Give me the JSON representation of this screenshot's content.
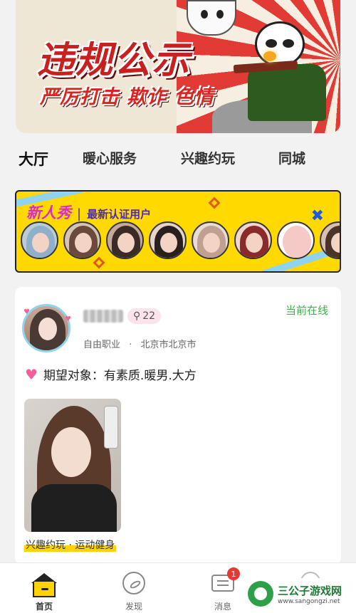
{
  "banner": {
    "title": "违规公示",
    "subtitle": "严厉打击 欺诈 色情"
  },
  "tabs": [
    {
      "label": "大厅",
      "active": true
    },
    {
      "label": "暖心服务",
      "active": false
    },
    {
      "label": "兴趣约玩",
      "active": false
    },
    {
      "label": "同城",
      "active": false
    }
  ],
  "new_members": {
    "title": "新人秀",
    "separator": "|",
    "subtitle": "最新认证用户",
    "avatar_colors": [
      "#8fb0c8",
      "#6a4a3c",
      "#3b2b26",
      "#2a1f1f",
      "#c0a090",
      "#8a2a2a",
      "#f4c9c6",
      "#4a3328"
    ]
  },
  "card": {
    "age": "22",
    "online_status": "当前在线",
    "occupation": "自由职业",
    "dot": "·",
    "location": "北京市北京市",
    "expect": "期望对象：有素质.暖男.大方",
    "tag": "兴趣约玩 · 运动健身"
  },
  "bottom_nav": [
    {
      "label": "首页",
      "active": true
    },
    {
      "label": "发现",
      "active": false
    },
    {
      "label": "消息",
      "active": false,
      "badge": "1"
    },
    {
      "label": "",
      "active": false
    }
  ],
  "watermark": {
    "title": "三公子游戏网",
    "url": "www.sangongzi.net"
  },
  "colors": {
    "accent": "#ffd400",
    "online": "#3cb24a",
    "badge": "#e53935"
  }
}
